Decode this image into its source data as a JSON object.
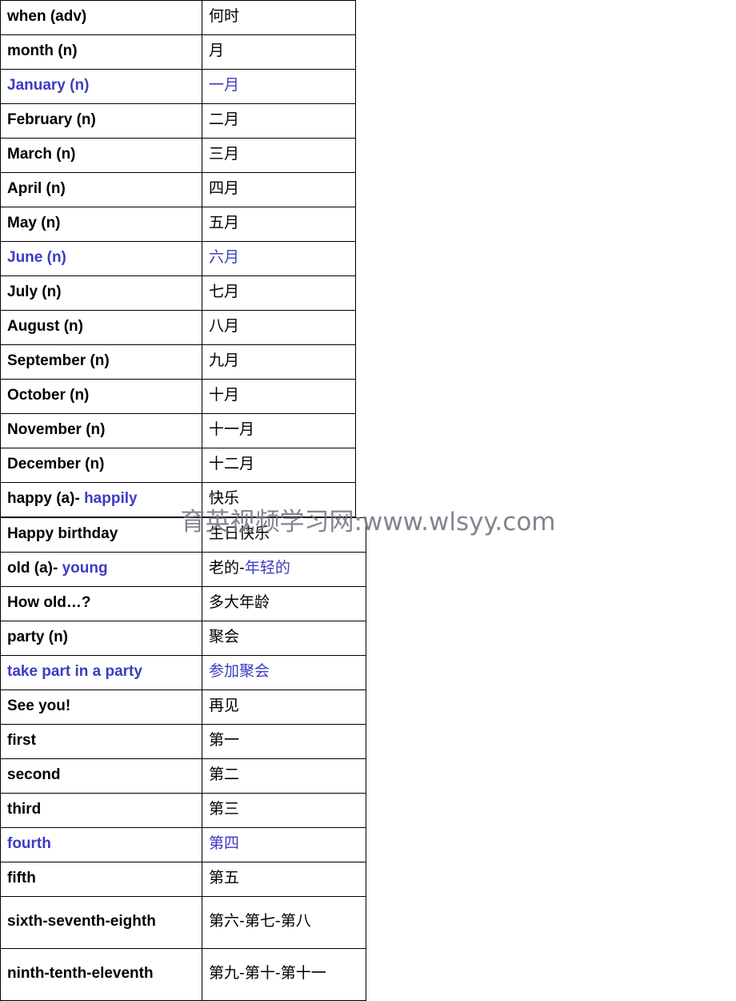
{
  "document": {
    "watermark": "育英视频学习网:www.wlsyy.com"
  },
  "left_table": {
    "rows": [
      {
        "en": "when (adv)",
        "cn": "何时",
        "en_blue": false,
        "cn_blue": false,
        "tall": false
      },
      {
        "en": "month (n)",
        "cn": "月",
        "en_blue": false,
        "cn_blue": false,
        "tall": false
      },
      {
        "en": "January (n)",
        "cn": "一月",
        "en_blue": true,
        "cn_blue": true,
        "tall": false
      },
      {
        "en": "February (n)",
        "cn": "二月",
        "en_blue": false,
        "cn_blue": false,
        "tall": false
      },
      {
        "en": "March (n)",
        "cn": "三月",
        "en_blue": false,
        "cn_blue": false,
        "tall": false
      },
      {
        "en": "April (n)",
        "cn": "四月",
        "en_blue": false,
        "cn_blue": false,
        "tall": false
      },
      {
        "en": "May (n)",
        "cn": "五月",
        "en_blue": false,
        "cn_blue": false,
        "tall": false
      },
      {
        "en": "June (n)",
        "cn": "六月",
        "en_blue": true,
        "cn_blue": true,
        "tall": false
      },
      {
        "en": "July (n)",
        "cn": "七月",
        "en_blue": false,
        "cn_blue": false,
        "tall": false
      },
      {
        "en": "August (n)",
        "cn": "八月",
        "en_blue": false,
        "cn_blue": false,
        "tall": false
      },
      {
        "en": "September (n)",
        "cn": "九月",
        "en_blue": false,
        "cn_blue": false,
        "tall": false
      },
      {
        "en": "October (n)",
        "cn": "十月",
        "en_blue": false,
        "cn_blue": false,
        "tall": false
      },
      {
        "en": "November (n)",
        "cn": "十一月",
        "en_blue": false,
        "cn_blue": false,
        "tall": false
      },
      {
        "en": "December (n)",
        "cn": "十二月",
        "en_blue": false,
        "cn_blue": false,
        "tall": false
      },
      {
        "en_parts": [
          {
            "text": "happy (a)- ",
            "blue": false
          },
          {
            "text": "happily",
            "blue": true
          }
        ],
        "cn": "快乐",
        "tall": false
      }
    ]
  },
  "right_table": {
    "rows": [
      {
        "en": "Happy birthday",
        "cn": "生日快乐",
        "en_blue": false,
        "cn_blue": false,
        "tall": false
      },
      {
        "en_parts": [
          {
            "text": "old (a)- ",
            "blue": false
          },
          {
            "text": "young",
            "blue": true
          }
        ],
        "cn_parts": [
          {
            "text": "老的-",
            "blue": false
          },
          {
            "text": "年轻的",
            "blue": true
          }
        ],
        "tall": false
      },
      {
        "en": "How old…?",
        "cn": "多大年龄",
        "en_blue": false,
        "cn_blue": false,
        "tall": false
      },
      {
        "en": "party (n)",
        "cn": "聚会",
        "en_blue": false,
        "cn_blue": false,
        "tall": false
      },
      {
        "en": "take part in a party",
        "cn": "参加聚会",
        "en_blue": true,
        "cn_blue": true,
        "tall": false
      },
      {
        "en": "See you!",
        "cn": "再见",
        "en_blue": false,
        "cn_blue": false,
        "tall": false
      },
      {
        "en": "first",
        "cn": "第一",
        "en_blue": false,
        "cn_blue": false,
        "tall": false
      },
      {
        "en": "second",
        "cn": "第二",
        "en_blue": false,
        "cn_blue": false,
        "tall": false
      },
      {
        "en": "third",
        "cn": "第三",
        "en_blue": false,
        "cn_blue": false,
        "tall": false
      },
      {
        "en": "fourth",
        "cn": "第四",
        "en_blue": true,
        "cn_blue": true,
        "tall": false
      },
      {
        "en": "fifth",
        "cn": "第五",
        "en_blue": false,
        "cn_blue": false,
        "tall": false
      },
      {
        "en": "sixth-seventh-eighth",
        "cn": "第六-第七-第八",
        "en_blue": false,
        "cn_blue": false,
        "tall": true
      },
      {
        "en": "ninth-tenth-eleventh",
        "cn": "第九-第十-第十一",
        "en_blue": false,
        "cn_blue": false,
        "tall": true
      }
    ]
  }
}
